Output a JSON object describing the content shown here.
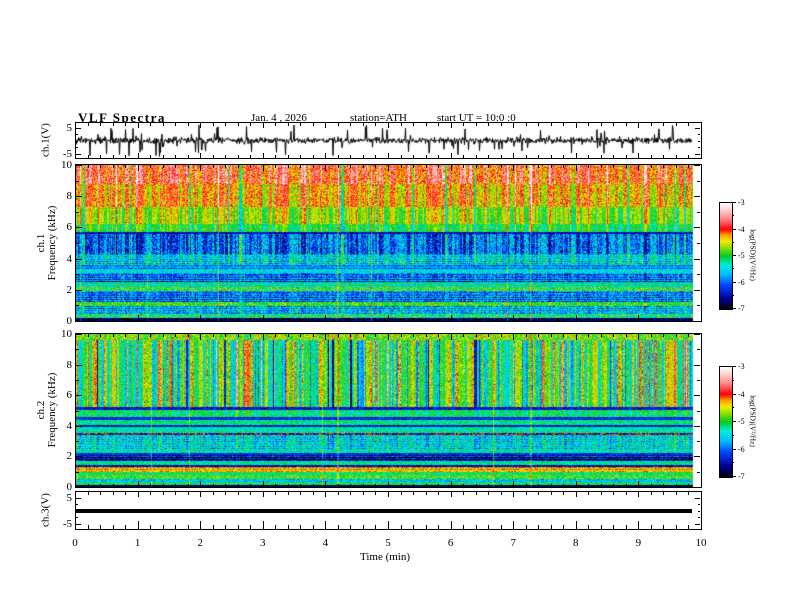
{
  "title": {
    "main": "VLF Spectra",
    "date": "Jan. 4 , 2026",
    "station": "station=ATH",
    "start_ut": "start UT =  10:0 :0"
  },
  "x_axis": {
    "label": "Time  (min)",
    "ticks": [
      "0",
      "1",
      "2",
      "3",
      "4",
      "5",
      "6",
      "7",
      "8",
      "9",
      "10"
    ],
    "min": 0,
    "max": 10
  },
  "panels": {
    "ch1_wave": {
      "ylabel": "ch.1(V)",
      "ytick_labels": [
        "5",
        "-5"
      ],
      "ymin": -5,
      "ymax": 5
    },
    "ch1_spec": {
      "ylabel_line1": "ch.1",
      "ylabel_line2": "Frequency  (kHz)",
      "ytick_labels": [
        "0",
        "2",
        "4",
        "6",
        "8",
        "10"
      ],
      "ymin": 0,
      "ymax": 10
    },
    "ch2_spec": {
      "ylabel_line1": "ch.2",
      "ylabel_line2": "Frequency  (kHz)",
      "ytick_labels": [
        "0",
        "2",
        "4",
        "6",
        "8",
        "10"
      ],
      "ymin": 0,
      "ymax": 10
    },
    "ch3_wave": {
      "ylabel": "ch.3(V)",
      "ytick_labels": [
        "5",
        "-5"
      ],
      "ymin": -5,
      "ymax": 5
    }
  },
  "colorbar": {
    "label": "log(PSD)(V²/Hz)",
    "ticks": [
      "-3",
      "-4",
      "-5",
      "-6",
      "-7"
    ],
    "min": -7,
    "max": -3
  },
  "chart_data": {
    "type": "heatmap",
    "subtype": "vlf-spectrogram-stack",
    "time_axis": {
      "label": "Time (min)",
      "min": 0,
      "max": 10,
      "data_end_min": 9.85,
      "major_tick_min": 1,
      "minor_tick_min": 0.2
    },
    "frequency_axis": {
      "label": "Frequency (kHz)",
      "min": 0,
      "max": 10,
      "major_tick_khz": 2,
      "minor_tick_khz": 1
    },
    "psd_scale": {
      "label": "log(PSD)(V²/Hz)",
      "min": -7,
      "max": -3
    },
    "colormap_stops": [
      [
        -7.0,
        "#000000"
      ],
      [
        -6.6,
        "#000099"
      ],
      [
        -6.1,
        "#0044ff"
      ],
      [
        -5.7,
        "#00bbff"
      ],
      [
        -5.35,
        "#00eedd"
      ],
      [
        -5.0,
        "#00cc22"
      ],
      [
        -4.7,
        "#88dd00"
      ],
      [
        -4.45,
        "#eeee00"
      ],
      [
        -4.2,
        "#ff9900"
      ],
      [
        -4.0,
        "#ff0000"
      ],
      [
        -3.6,
        "#ff8888"
      ],
      [
        -3.2,
        "#ffdddd"
      ],
      [
        -3.0,
        "#ffffff"
      ]
    ],
    "event_times_min": [
      4.17,
      7.25
    ],
    "waveforms": {
      "ch1": {
        "units": "V",
        "display_range": [
          -5,
          5
        ],
        "character": "broadband noise with bipolar impulses",
        "noise_sigma_v": 0.6,
        "spike_probability": 0.08,
        "spike_max_v": 6
      },
      "ch3": {
        "units": "V",
        "display_range": [
          -5,
          5
        ],
        "character": "constant flat line",
        "value_v": 0,
        "line_thickness_px": 4
      }
    },
    "spectrogram_bands": {
      "ch1": [
        {
          "f": [
            8.8,
            10.01
          ],
          "v": -3.9,
          "nv": 0.45,
          "st": 0.55
        },
        {
          "f": [
            7.3,
            8.8
          ],
          "v": -4.25,
          "nv": 0.4,
          "st": 0.5
        },
        {
          "f": [
            6.2,
            7.3
          ],
          "v": -4.65,
          "nv": 0.3,
          "st": 0.45
        },
        {
          "f": [
            5.7,
            6.2
          ],
          "v": -5.0,
          "nv": 0.25,
          "st": 0.35
        },
        {
          "f": [
            5.55,
            5.7
          ],
          "v": -6.5,
          "nv": 0.25,
          "st": 0
        },
        {
          "f": [
            4.3,
            5.55
          ],
          "v": -6.0,
          "nv": 0.55,
          "st": -0.5
        },
        {
          "f": [
            3.6,
            4.3
          ],
          "v": -5.5,
          "nv": 0.45,
          "st": -0.3,
          "rows": 0.25
        },
        {
          "f": [
            3.35,
            3.6
          ],
          "v": -5.85,
          "nv": 0.35,
          "st": 0,
          "rows": 0.3
        },
        {
          "f": [
            3.05,
            3.35
          ],
          "v": -5.45,
          "nv": 0.35,
          "st": 0
        },
        {
          "f": [
            2.5,
            3.05
          ],
          "v": -6.0,
          "nv": 0.5,
          "st": -0.2,
          "rows": 0.35
        },
        {
          "f": [
            2.15,
            2.5
          ],
          "v": -5.3,
          "nv": 0.5,
          "st": 0
        },
        {
          "f": [
            1.95,
            2.15
          ],
          "v": -5.0,
          "nv": 0.45,
          "st": 0,
          "dash": {
            "p": 0.1,
            "v": -4.2
          }
        },
        {
          "f": [
            1.25,
            1.95
          ],
          "v": -5.95,
          "nv": 0.5,
          "st": -0.2,
          "rows": 0.3
        },
        {
          "f": [
            0.95,
            1.25
          ],
          "v": -4.9,
          "nv": 0.35,
          "st": 0.15
        },
        {
          "f": [
            0.45,
            0.95
          ],
          "v": -5.65,
          "nv": 0.55,
          "st": -0.2,
          "rows": 0.25
        },
        {
          "f": [
            0.2,
            0.45
          ],
          "v": -5.15,
          "nv": 0.6,
          "st": 0
        },
        {
          "f": [
            0.0,
            0.2
          ],
          "v": -6.75,
          "nv": 0.35,
          "st": 0
        }
      ],
      "ch2": [
        {
          "f": [
            9.6,
            10.01
          ],
          "v": -4.7,
          "nv": 0.4,
          "st": 0.3
        },
        {
          "f": [
            5.2,
            9.6
          ],
          "v": -5.05,
          "nv": 0.35,
          "st": -0.85
        },
        {
          "f": [
            5.05,
            5.2
          ],
          "v": -6.4,
          "nv": 0.3,
          "st": 0
        },
        {
          "f": [
            4.55,
            5.05
          ],
          "v": -5.15,
          "nv": 0.3,
          "st": -0.2
        },
        {
          "f": [
            4.4,
            4.55
          ],
          "v": -6.3,
          "nv": 0.3,
          "st": 0
        },
        {
          "f": [
            4.05,
            4.4
          ],
          "v": -5.2,
          "nv": 0.3,
          "st": 0
        },
        {
          "f": [
            3.9,
            4.05
          ],
          "v": -6.4,
          "nv": 0.3,
          "st": 0
        },
        {
          "f": [
            3.55,
            3.9
          ],
          "v": -5.3,
          "nv": 0.35,
          "st": 0
        },
        {
          "f": [
            3.38,
            3.55
          ],
          "v": -6.6,
          "nv": 0.3,
          "st": 0,
          "dash": {
            "p": 0.45,
            "v": -4.05
          }
        },
        {
          "f": [
            2.45,
            3.38
          ],
          "v": -5.5,
          "nv": 0.45,
          "st": -0.25,
          "rows": 0.2
        },
        {
          "f": [
            2.25,
            2.45
          ],
          "v": -5.3,
          "nv": 0.35,
          "st": 0
        },
        {
          "f": [
            1.95,
            2.25
          ],
          "v": -6.35,
          "nv": 0.4,
          "st": 0,
          "rows": 0.3
        },
        {
          "f": [
            1.7,
            1.95
          ],
          "v": -6.65,
          "nv": 0.5,
          "st": 0,
          "rows": 0.3
        },
        {
          "f": [
            1.45,
            1.7
          ],
          "v": -5.25,
          "nv": 0.4,
          "st": 0
        },
        {
          "f": [
            1.28,
            1.45
          ],
          "v": -6.5,
          "nv": 0.35,
          "st": 0
        },
        {
          "f": [
            0.95,
            1.28
          ],
          "v": -4.35,
          "nv": 0.3,
          "st": 0,
          "rows": 0.2
        },
        {
          "f": [
            0.8,
            0.95
          ],
          "v": -5.1,
          "nv": 0.35,
          "st": 0
        },
        {
          "f": [
            0.55,
            0.8
          ],
          "v": -4.9,
          "nv": 0.4,
          "st": 0
        },
        {
          "f": [
            0.35,
            0.55
          ],
          "v": -5.6,
          "nv": 0.45,
          "st": 0
        },
        {
          "f": [
            0.15,
            0.35
          ],
          "v": -5.15,
          "nv": 0.4,
          "st": 0
        },
        {
          "f": [
            0.0,
            0.15
          ],
          "v": -6.85,
          "nv": 0.25,
          "st": 0
        }
      ]
    }
  }
}
